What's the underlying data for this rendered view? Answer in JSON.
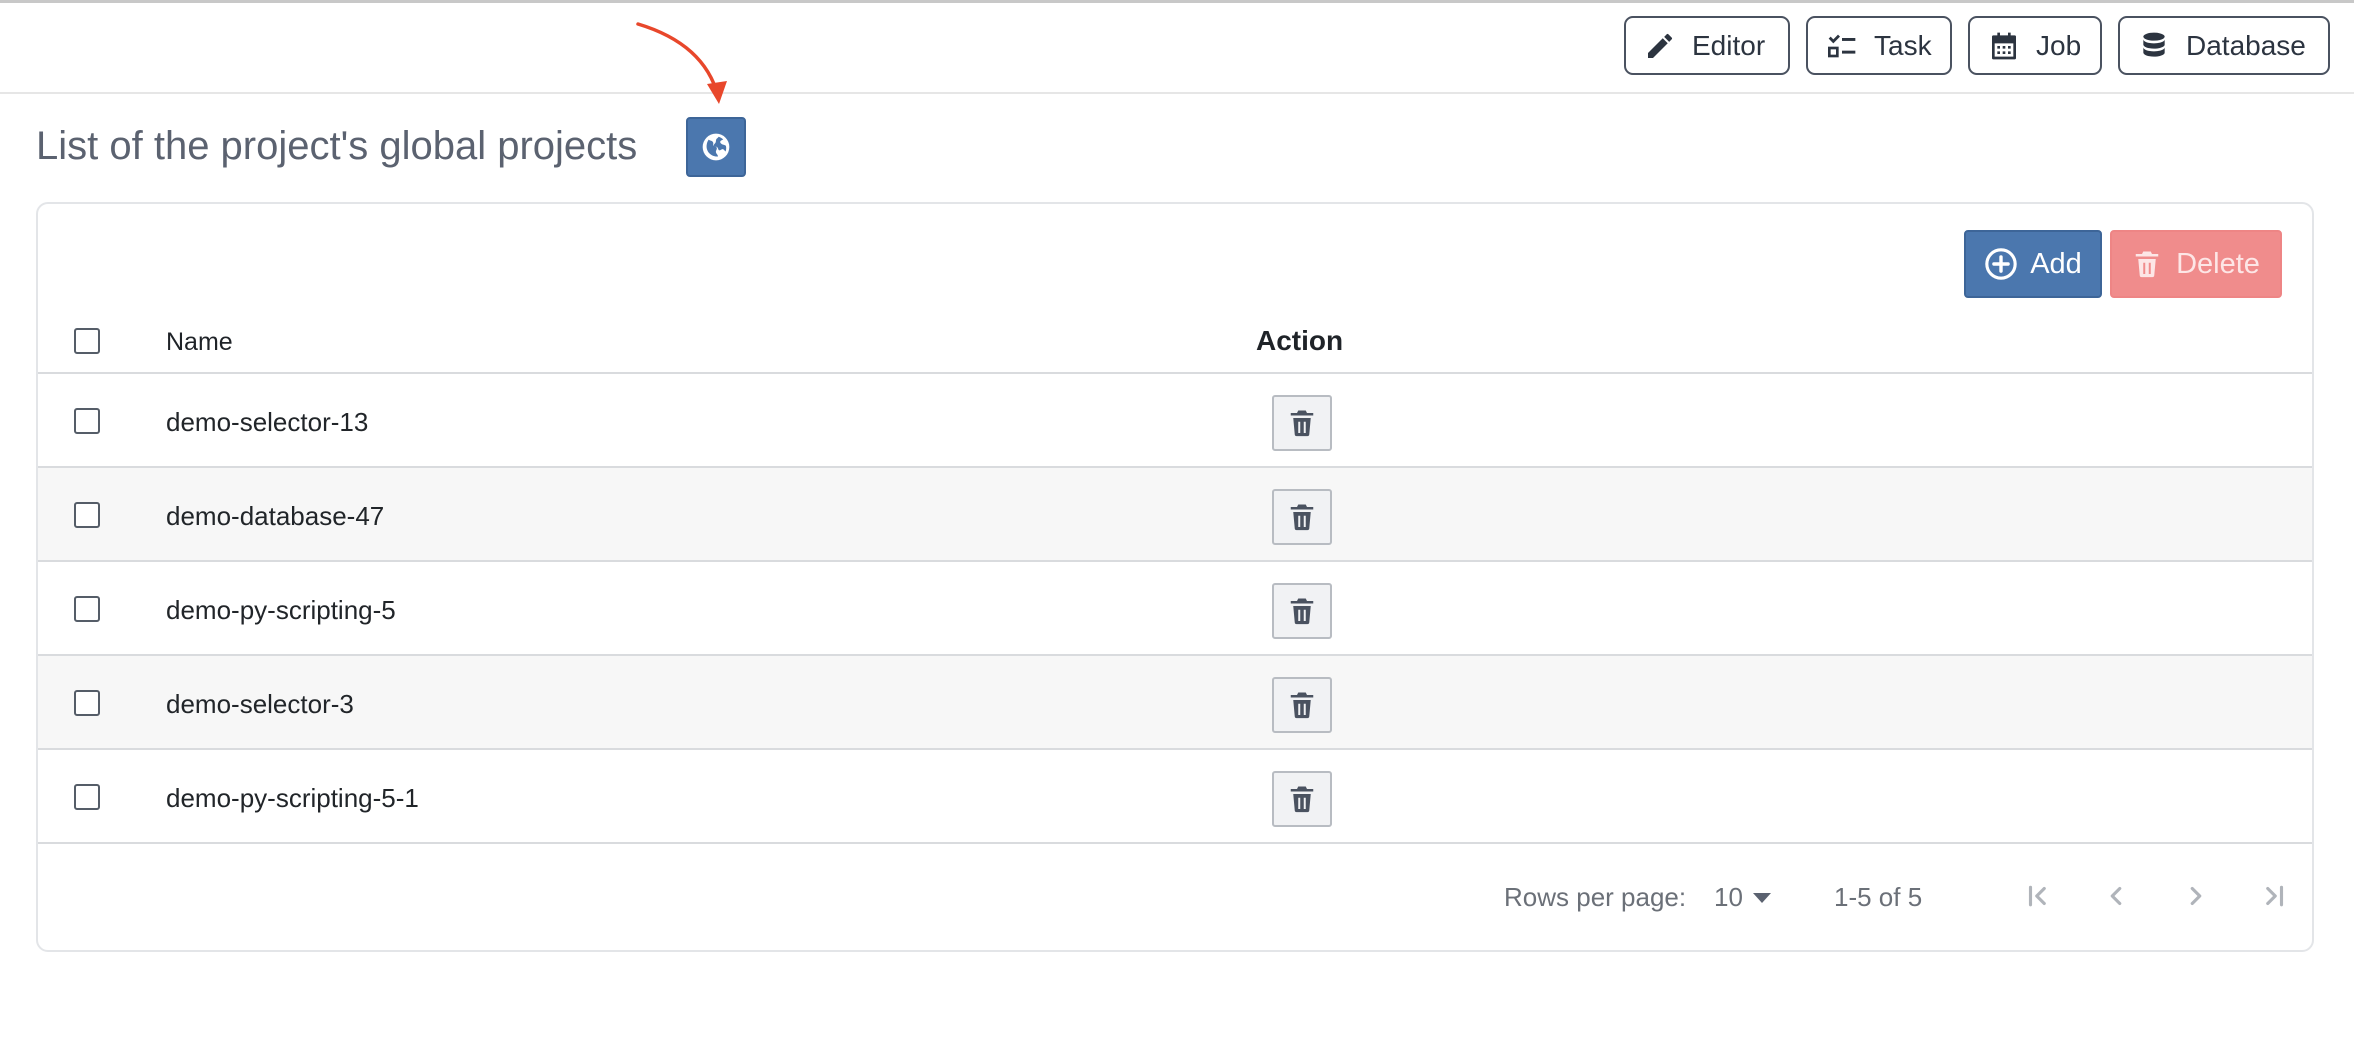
{
  "toolbar": {
    "buttons": [
      {
        "label": "Editor",
        "icon": "pencil-icon"
      },
      {
        "label": "Task",
        "icon": "checklist-icon"
      },
      {
        "label": "Job",
        "icon": "calendar-icon"
      },
      {
        "label": "Database",
        "icon": "database-icon"
      }
    ]
  },
  "page": {
    "title": "List of the project's global projects",
    "globe_icon": "globe-icon"
  },
  "actions": {
    "add_label": "Add",
    "delete_label": "Delete"
  },
  "table": {
    "columns": [
      "Name",
      "Action"
    ],
    "rows": [
      {
        "name": "demo-selector-13"
      },
      {
        "name": "demo-database-47"
      },
      {
        "name": "demo-py-scripting-5"
      },
      {
        "name": "demo-selector-3"
      },
      {
        "name": "demo-py-scripting-5-1"
      }
    ]
  },
  "pagination": {
    "rows_per_page_label": "Rows per page:",
    "rows_per_page_value": "10",
    "range": "1-5 of 5"
  },
  "colors": {
    "primary": "#4b77ae",
    "danger_disabled": "#f08c8c",
    "annotation_arrow": "#e8472b"
  }
}
